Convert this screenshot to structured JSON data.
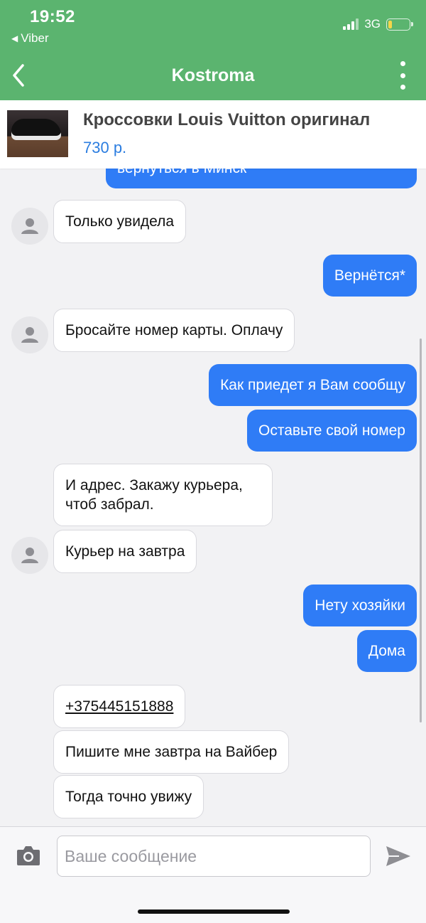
{
  "status_bar": {
    "time": "19:52",
    "back_app": "Viber",
    "network": "3G",
    "battery_level": 0.2
  },
  "nav": {
    "title": "Kostroma"
  },
  "product": {
    "title": "Кроссовки Louis Vuitton оригинал",
    "price": "730 р."
  },
  "messages": [
    {
      "dir": "out",
      "text": "вернуться в Минск"
    },
    {
      "dir": "in",
      "text": "Только увидела"
    },
    {
      "dir": "out",
      "text": "Вернётся*"
    },
    {
      "dir": "in",
      "text": "Бросайте номер карты. Оплачу"
    },
    {
      "dir": "out",
      "text": "Как приедет я Вам сообщу"
    },
    {
      "dir": "out",
      "text": "Оставьте свой номер"
    },
    {
      "dir": "in",
      "text": "И адрес. Закажу курьера,"
    },
    {
      "dir": "in",
      "text": "чтоб забрал."
    },
    {
      "dir": "in",
      "text": "Курьер на завтра"
    },
    {
      "dir": "out",
      "text": "Нету хозяйки"
    },
    {
      "dir": "out",
      "text": "Дома"
    },
    {
      "dir": "in",
      "text": "+375445151888"
    },
    {
      "dir": "in",
      "text": "Пишите мне завтра на Вайбер"
    },
    {
      "dir": "in",
      "text": "Тогда точно увижу"
    }
  ],
  "input": {
    "placeholder": "Ваше сообщение"
  },
  "colors": {
    "header": "#5bb46f",
    "outgoing_bubble": "#2f7cf6",
    "price": "#2b7de0"
  }
}
